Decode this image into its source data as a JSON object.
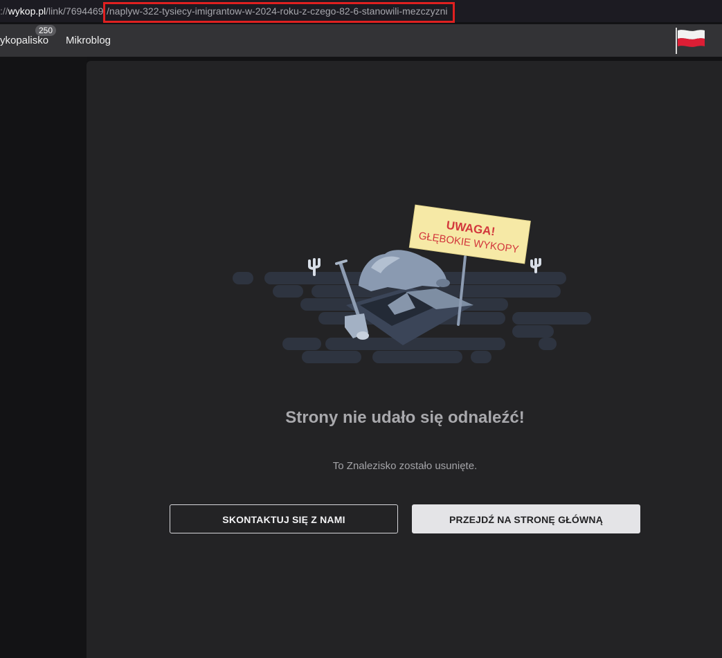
{
  "browser": {
    "url_prefix": "://",
    "url_host": "wykop.pl",
    "url_path": "/link/7694469",
    "url_slug": "/naplyw-322-tysiecy-imigrantow-w-2024-roku-z-czego-82-6-stanowili-mezczyzni"
  },
  "nav": {
    "items": [
      {
        "label": "ykopalisko",
        "badge": "250"
      },
      {
        "label": "Mikroblog"
      }
    ],
    "language_flag": "poland-flag-icon"
  },
  "illustration": {
    "sign_line1": "UWAGA!",
    "sign_line2": "GŁĘBOKIE WYKOPY",
    "icon": "digging-hole-illustration"
  },
  "error": {
    "title": "Strony nie udało się odnaleźć!",
    "message": "To Znalezisko zostało usunięte."
  },
  "buttons": {
    "contact": "SKONTAKTUJ SIĘ Z NAMI",
    "home": "PRZEJDŹ NA STRONĘ GŁÓWNĄ"
  },
  "colors": {
    "card_bg": "#232325",
    "nav_bg": "#333336",
    "sign_bg": "#f6e9a6",
    "sign_text": "#d2373c",
    "highlight": "#e02020"
  }
}
